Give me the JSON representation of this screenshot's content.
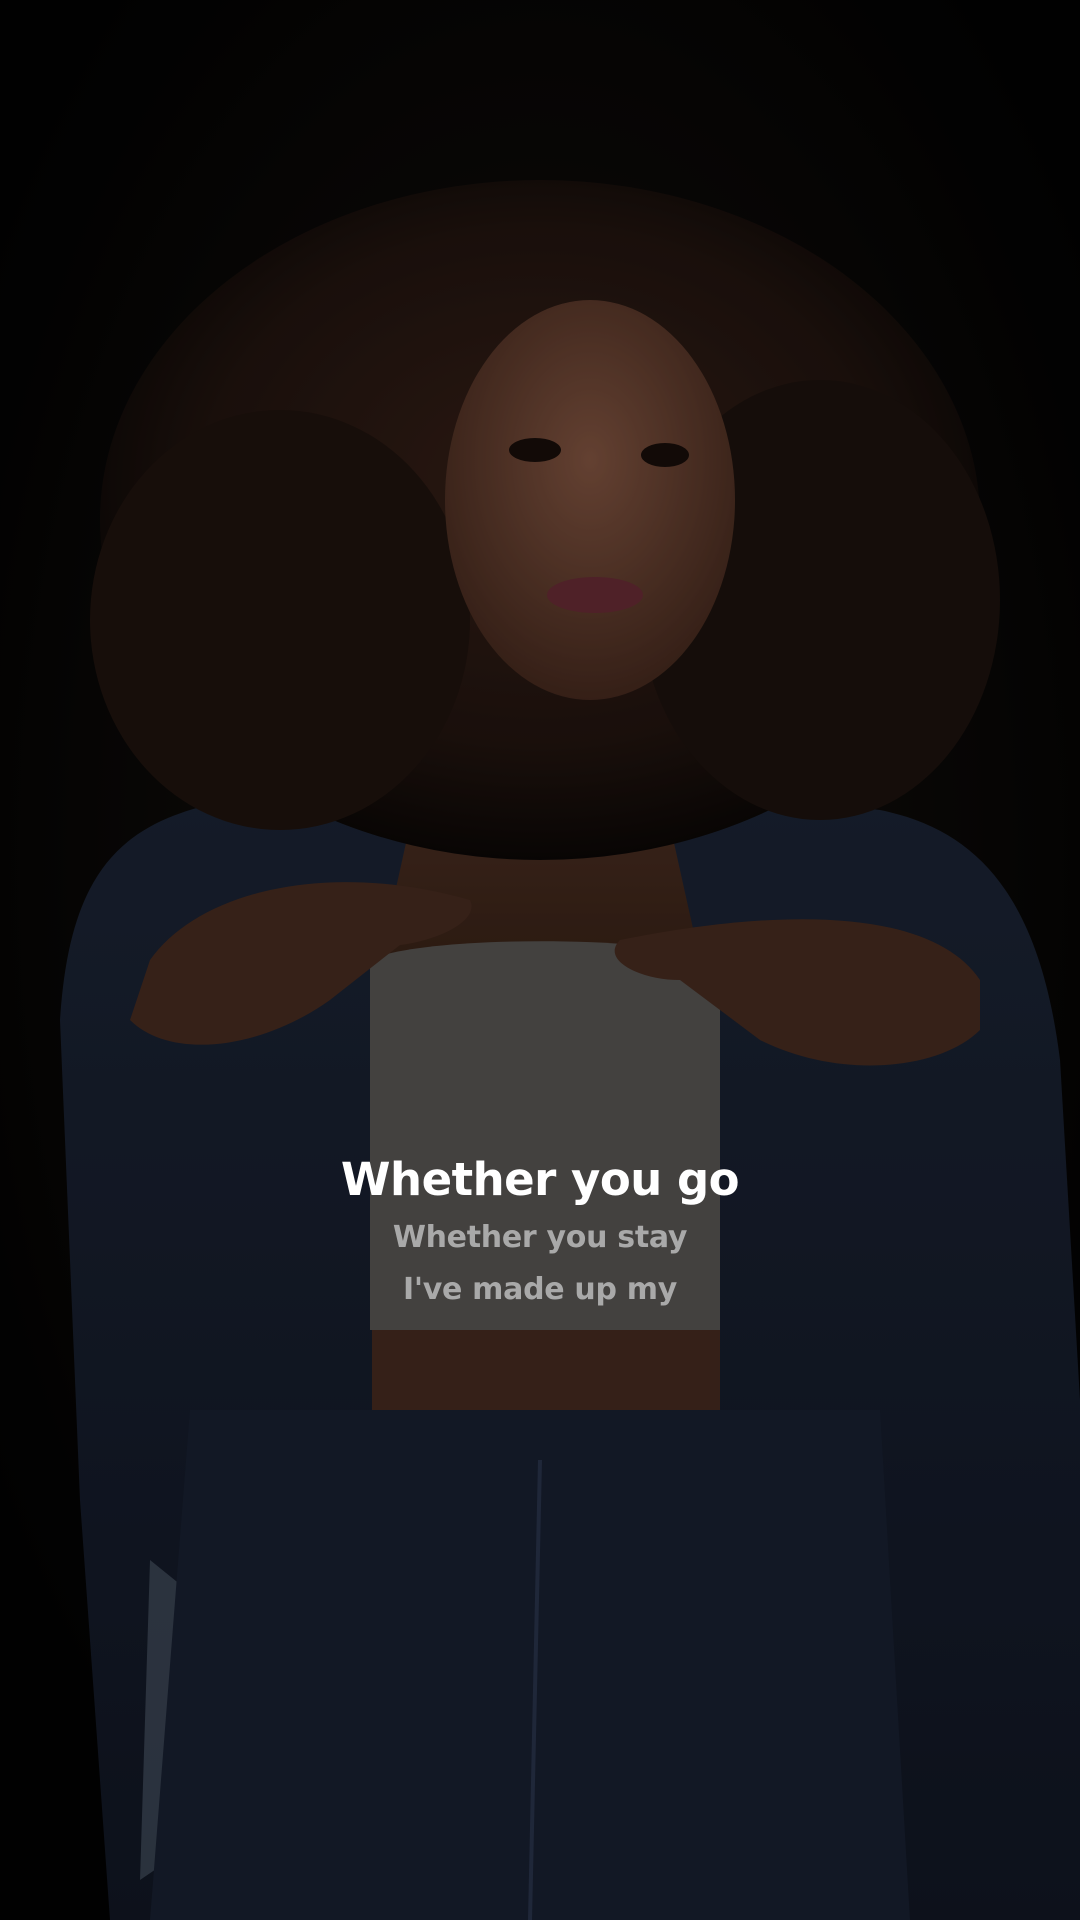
{
  "background": {
    "image": "portrait-photo",
    "overlay_color": "#000000"
  },
  "lyrics": {
    "current_line": "Whether you go",
    "next_lines": [
      "Whether you stay",
      "I've made up my"
    ],
    "current_color": "#ffffff",
    "next_color": "#a9a9a9"
  }
}
